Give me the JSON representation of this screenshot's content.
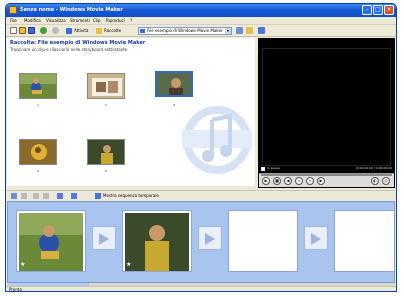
{
  "window": {
    "title": "Senza nome - Windows Movie Maker"
  },
  "menu": [
    {
      "label": "File"
    },
    {
      "label": "Modifica"
    },
    {
      "label": "Visualizza"
    },
    {
      "label": "Strumenti"
    },
    {
      "label": "Clip"
    },
    {
      "label": "Riproduci"
    },
    {
      "label": "?"
    }
  ],
  "toolbar": {
    "tasks_label": "Attività",
    "collections_label": "Raccolte",
    "collection_select_value": "File esempio di Windows Movie Maker"
  },
  "collection": {
    "title": "Raccolta: File esempio di Windows Movie Maker",
    "subtitle": "Trascinare un clip e rilasciarlo nelle storyboard sottostante.",
    "clips": [
      {
        "label": "1"
      },
      {
        "label": "2"
      },
      {
        "label": "3"
      },
      {
        "label": "4"
      },
      {
        "label": "5"
      }
    ]
  },
  "monitor": {
    "status_left": "In pausa",
    "status_right": "0:00:00,00 / 0:00:00,00"
  },
  "storyboard": {
    "toggle_label": "Mostra sequenza temporale"
  },
  "statusbar": {
    "text": "Pronto"
  },
  "colors": {
    "titlebar": "#1759d6",
    "storyboard_bg": "#a9c4ef",
    "selection": "#316ac5"
  }
}
